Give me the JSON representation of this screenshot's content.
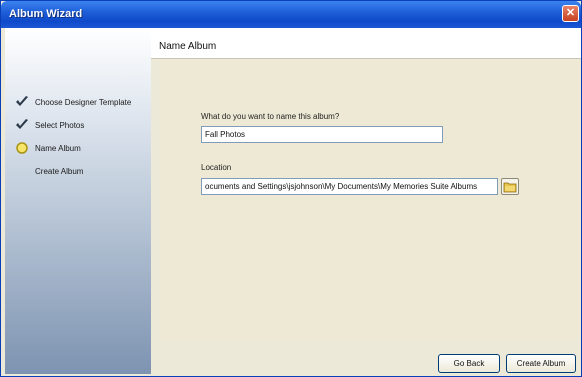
{
  "window": {
    "title": "Album Wizard",
    "close_glyph": "✕"
  },
  "sidebar": {
    "steps": [
      {
        "label": "Choose Designer Template",
        "icon": "check-icon",
        "status": "done"
      },
      {
        "label": "Select Photos",
        "icon": "check-icon",
        "status": "done"
      },
      {
        "label": "Name Album",
        "icon": "current-step-icon",
        "status": "current"
      },
      {
        "label": "Create Album",
        "icon": "",
        "status": "pending"
      }
    ]
  },
  "header": {
    "title": "Name Album"
  },
  "form": {
    "name_label": "What do you want to name this album?",
    "name_value": "Fall Photos",
    "location_label": "Location",
    "location_value": "ocuments and Settings\\jsjohnson\\My Documents\\My Memories Suite Albums",
    "browse_icon": "folder-icon"
  },
  "buttons": {
    "back": "Go Back",
    "create": "Create Album"
  },
  "colors": {
    "titlebar": "#0e49c9",
    "check": "#2d3a4a",
    "current": "#d6c21e"
  }
}
